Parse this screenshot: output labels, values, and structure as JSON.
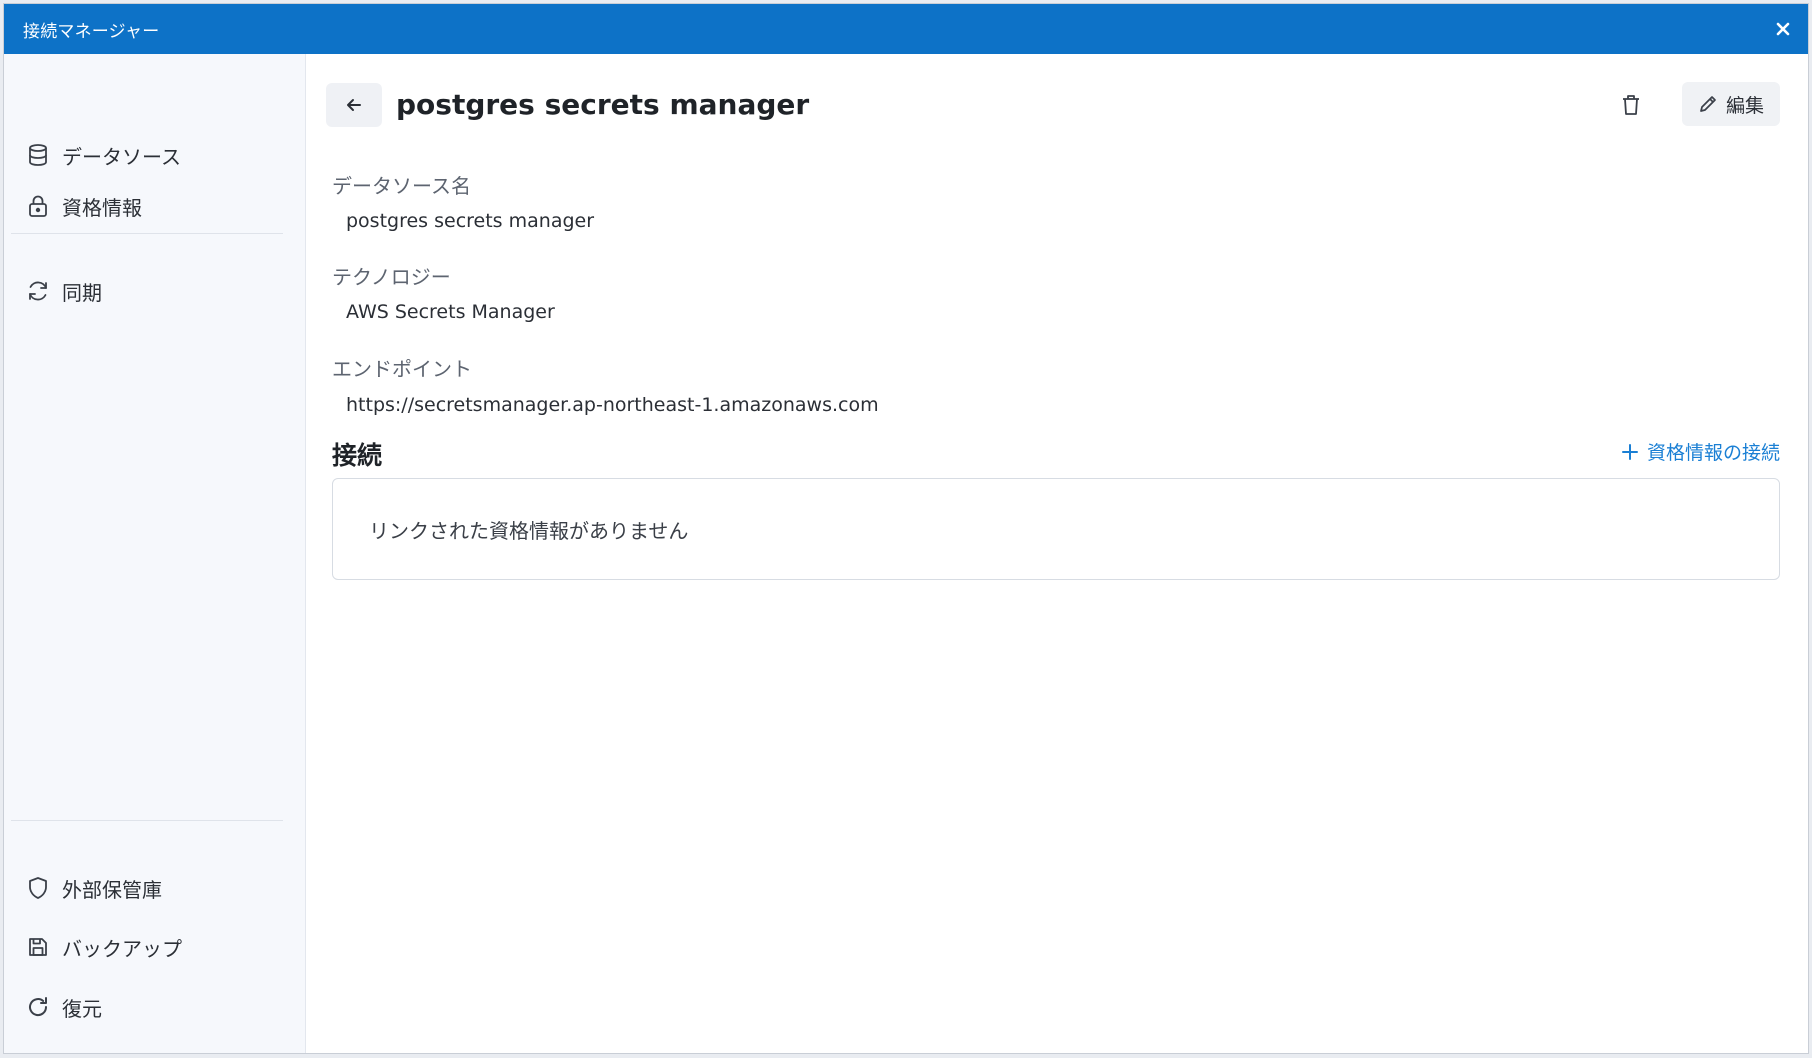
{
  "window": {
    "title": "接続マネージャー"
  },
  "sidebar": {
    "top_items": [
      {
        "label": "データソース",
        "icon": "database-icon"
      },
      {
        "label": "資格情報",
        "icon": "lock-icon"
      }
    ],
    "mid_items": [
      {
        "label": "同期",
        "icon": "sync-icon"
      }
    ],
    "bottom_items": [
      {
        "label": "外部保管庫",
        "icon": "shield-icon"
      },
      {
        "label": "バックアップ",
        "icon": "save-icon"
      },
      {
        "label": "復元",
        "icon": "restore-icon"
      }
    ]
  },
  "detail": {
    "title": "postgres secrets manager",
    "edit_label": "編集",
    "fields": [
      {
        "label": "データソース名",
        "value": "postgres secrets manager"
      },
      {
        "label": "テクノロジー",
        "value": "AWS Secrets Manager"
      },
      {
        "label": "エンドポイント",
        "value": "https://secretsmanager.ap-northeast-1.amazonaws.com"
      }
    ],
    "connections": {
      "title": "接続",
      "add_label": "資格情報の接続",
      "empty_text": "リンクされた資格情報がありません"
    }
  },
  "colors": {
    "titlebar": "#0d72c7",
    "accent": "#1a7fd4",
    "sidebar_bg": "#f6f8fc"
  }
}
